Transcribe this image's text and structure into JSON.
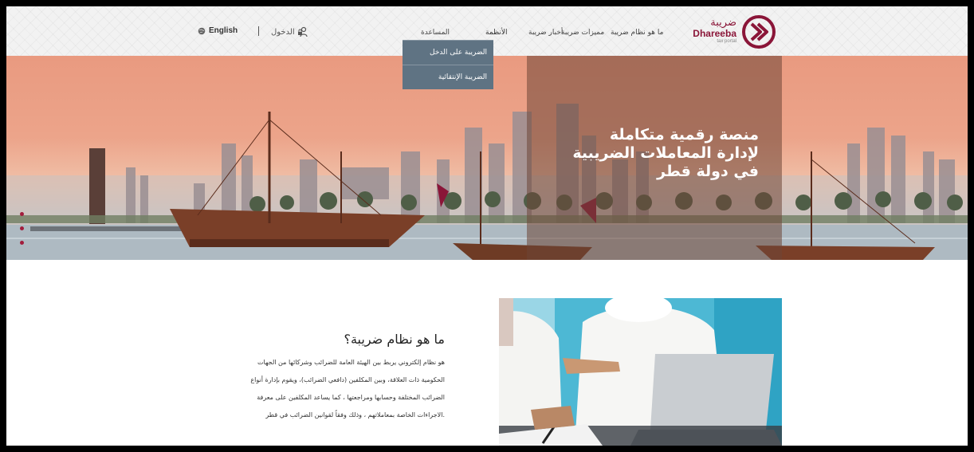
{
  "brand": {
    "name_ar": "ضريبة",
    "name_en": "Dhareeba",
    "tagline": "tax portal",
    "color": "#8a1538"
  },
  "nav": {
    "items": [
      {
        "label": "ما هو نظام ضريبة"
      },
      {
        "label": "مميزات ضريبة"
      },
      {
        "label": "أخبار ضريبة"
      },
      {
        "label": "الأنظمة"
      },
      {
        "label": "المساعدة"
      }
    ],
    "login_label": "الدخول",
    "language_label": "English"
  },
  "dropdown": {
    "items": [
      {
        "label": "الضريبة على الدخل"
      },
      {
        "label": "الضريبة الإنتقائية"
      }
    ],
    "background": "#5f7383"
  },
  "hero": {
    "title_lines": [
      "منصة رقمية متكاملة",
      "لإدارة المعاملات الضريبية",
      "في دولة قطر"
    ]
  },
  "about": {
    "title": "ما هو نظام ضريبة؟",
    "body_lines": [
      "هو نظام إلكتروني يربط بين الهيئة العامة للضرائب وشركائها من الجهات",
      "الحكومية ذات العلاقة، وبين المكلفين (دافعي الضرائب)، ويقوم بإدارة أنواع",
      "الضرائب المختلفة وحسابها ومراجعتها ، كما يساعد المكلفين على معرفة",
      "الاجراءات الخاصة بمعاملاتهم ، وذلك وفقاً لقوانين الضرائب في قطر."
    ]
  },
  "icons": {
    "login": "lock-user-icon",
    "language": "globe-icon",
    "logo": "dhareeba-chevron-logo"
  }
}
